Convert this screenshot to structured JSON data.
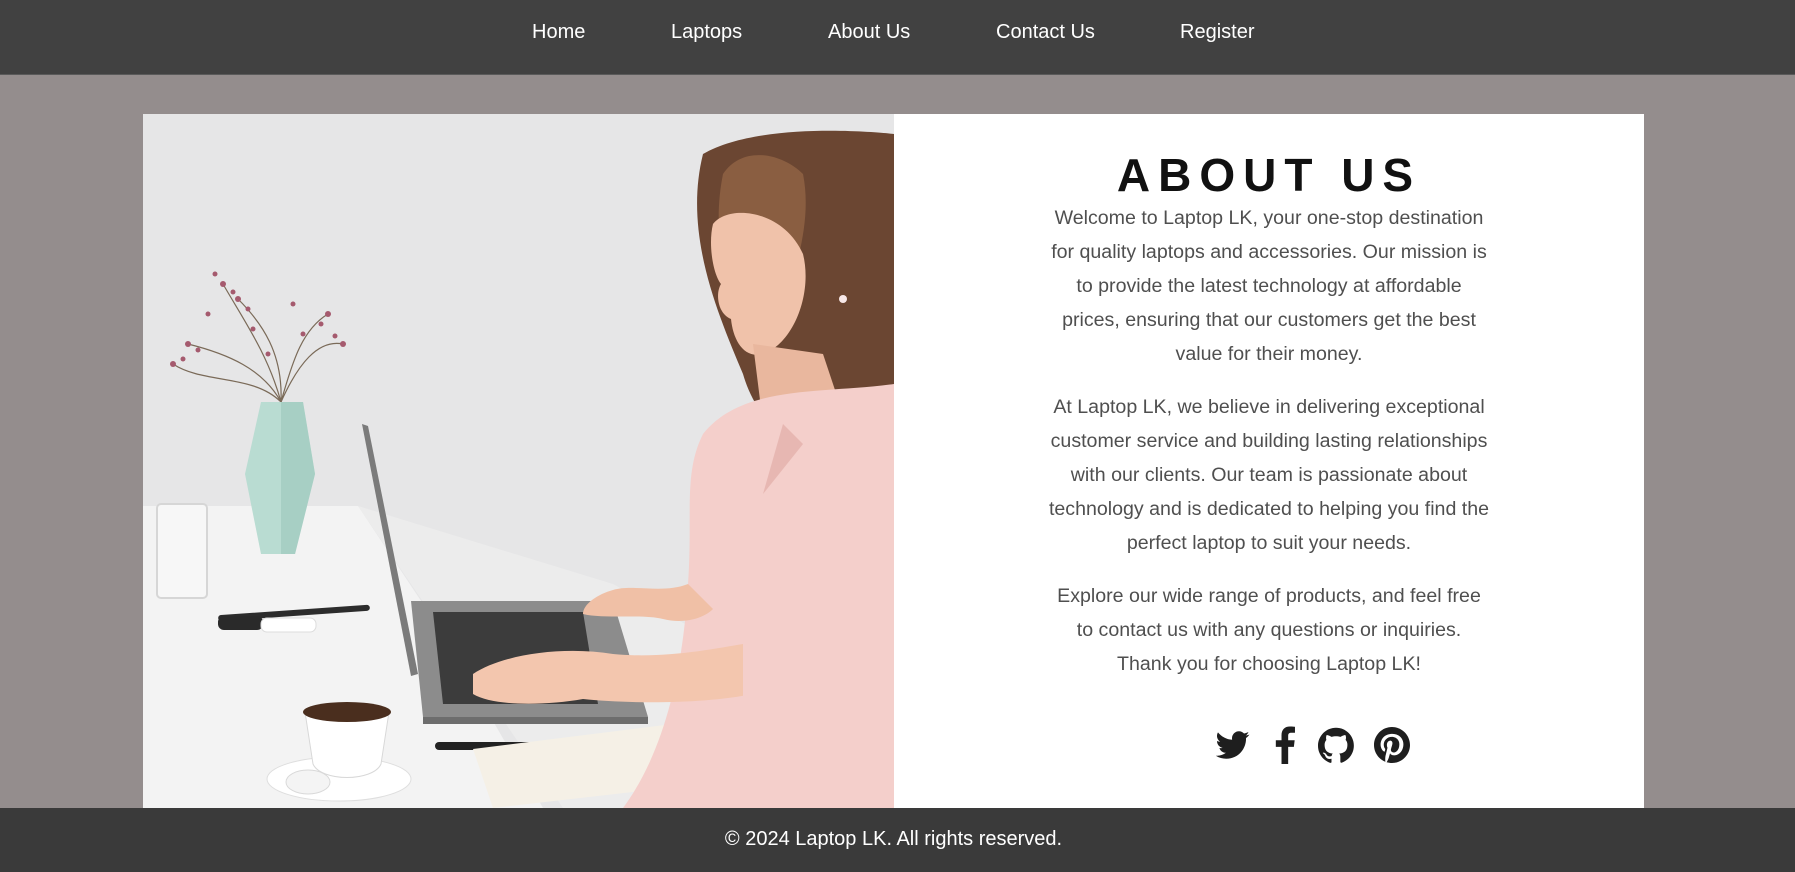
{
  "nav": {
    "items": [
      {
        "label": "Home"
      },
      {
        "label": "Laptops"
      },
      {
        "label": "About Us"
      },
      {
        "label": "Contact Us"
      },
      {
        "label": "Register"
      }
    ]
  },
  "about": {
    "title": "ABOUT US",
    "paragraphs": [
      {
        "lines": [
          "Welcome to Laptop LK, your one-stop destination",
          "for quality laptops and accessories. Our mission is",
          "to provide the latest technology at affordable",
          "prices, ensuring that our customers get the best",
          "value for their money."
        ]
      },
      {
        "lines": [
          "At Laptop LK, we believe in delivering exceptional",
          "customer service and building lasting relationships",
          "with our clients. Our team is passionate about",
          "technology and is dedicated to helping you find the",
          "perfect laptop to suit your needs."
        ]
      },
      {
        "lines": [
          "Explore our wide range of products, and feel free",
          "to contact us with any questions or inquiries.",
          "Thank you for choosing Laptop LK!"
        ]
      }
    ],
    "social_icons": [
      "twitter-icon",
      "facebook-icon",
      "github-icon",
      "pinterest-icon"
    ]
  },
  "footer": {
    "copyright": "© 2024 Laptop LK. All rights reserved."
  },
  "colors": {
    "nav_bg": "#414141",
    "page_bg": "#948d8d",
    "footer_bg": "#3a3a3a",
    "card_bg": "#ffffff",
    "title": "#111111",
    "body_text": "#4f4f4f"
  }
}
